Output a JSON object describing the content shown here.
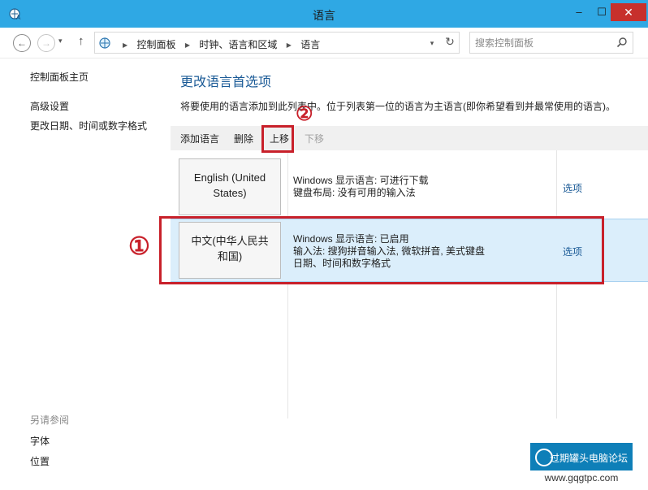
{
  "window": {
    "title": "语言",
    "minimize": "–",
    "maximize": "☐",
    "close": "✕"
  },
  "address": {
    "crumbs": [
      "控制面板",
      "时钟、语言和区域",
      "语言"
    ],
    "search_placeholder": "搜索控制面板"
  },
  "sidebar": {
    "home": "控制面板主页",
    "advanced": "高级设置",
    "date_format": "更改日期、时间或数字格式",
    "see_also": "另请参阅",
    "font": "字体",
    "location": "位置"
  },
  "main": {
    "title": "更改语言首选项",
    "description": "将要使用的语言添加到此列表中。位于列表第一位的语言为主语言(即你希望看到并最常使用的语言)。"
  },
  "toolbar": {
    "add": "添加语言",
    "remove": "删除",
    "move_up": "上移",
    "move_down": "下移"
  },
  "languages": [
    {
      "name": "English (United States)",
      "display": "Windows 显示语言: 可进行下载",
      "detail1": "键盘布局: 没有可用的输入法",
      "detail2": "",
      "options": "选项"
    },
    {
      "name": "中文(中华人民共和国)",
      "display": "Windows 显示语言: 已启用",
      "detail1": "输入法: 搜狗拼音输入法, 微软拼音, 美式键盘",
      "detail2": "日期、时间和数字格式",
      "options": "选项"
    }
  ],
  "annotations": {
    "marker1": "①",
    "marker2": "②",
    "color": "#c8202a"
  },
  "watermark": {
    "name": "过期罐头电脑论坛",
    "url": "www.gqgtpc.com"
  },
  "colors": {
    "titlebar": "#2fa8e4",
    "link": "#1a5a96",
    "selected_row": "#dbeefb"
  }
}
